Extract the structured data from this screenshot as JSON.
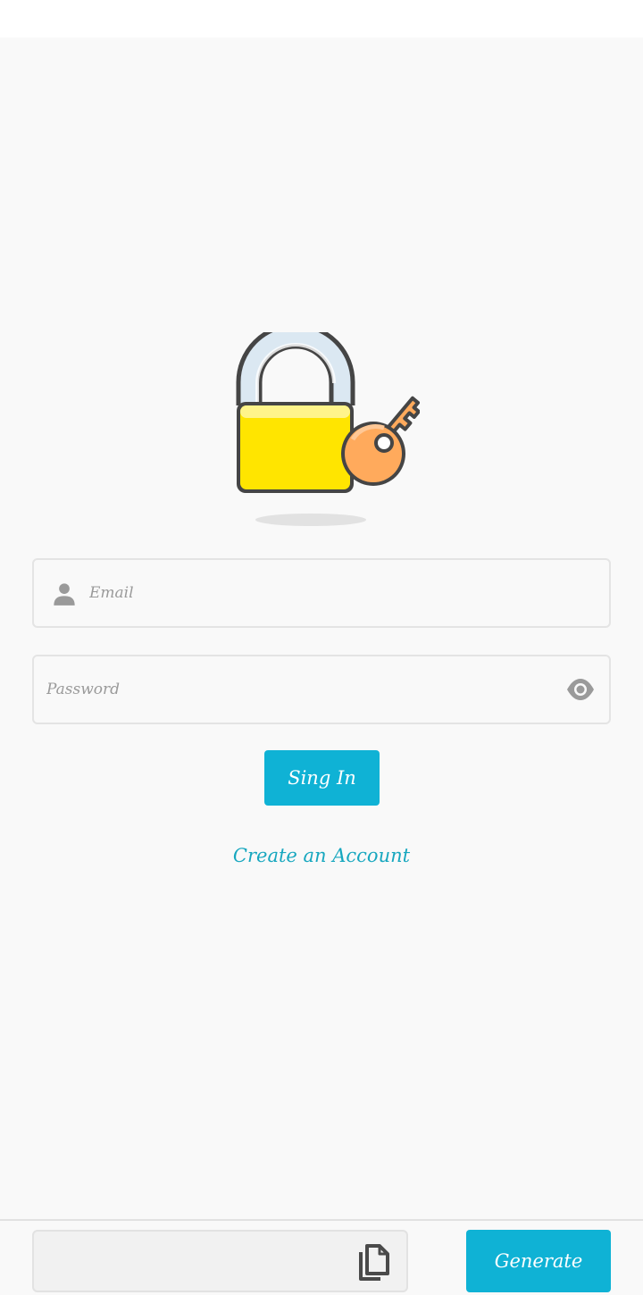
{
  "login": {
    "email_placeholder": "Email",
    "password_placeholder": "Password",
    "signin_label": "Sing In",
    "create_account_label": "Create an Account"
  },
  "generator": {
    "output_value": "",
    "generate_label": "Generate"
  },
  "colors": {
    "accent": "#0fb2d5",
    "link": "#17a7bf",
    "background": "#f9f9f9",
    "lock_body": "#ffe500",
    "key": "#ffaa5c"
  },
  "icons": {
    "logo": "padlock-with-key-icon",
    "email": "person-icon",
    "password_toggle": "eye-icon",
    "copy": "copy-icon"
  }
}
